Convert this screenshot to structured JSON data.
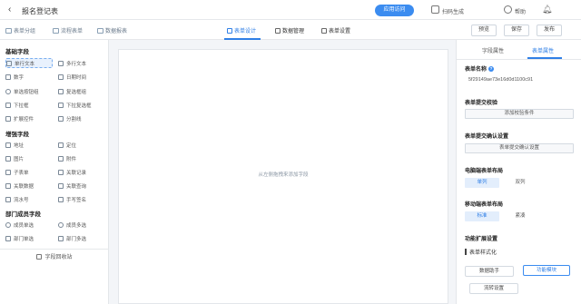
{
  "header": {
    "back_icon": "chevron-left-icon",
    "title": "报名登记表",
    "primary_button": "应用访问",
    "share_label": "扫码生成",
    "help_label": "帮助",
    "bell_icon": "bell-icon"
  },
  "subnav": {
    "left_tabs": [
      "表单分组",
      "流程表单",
      "数据报表"
    ],
    "center_tabs": [
      "表单设计",
      "数据管理",
      "表单设置"
    ],
    "active_center_tab": "表单设计",
    "buttons": [
      "预览",
      "保存",
      "发布"
    ]
  },
  "left_panel": {
    "sections": [
      {
        "title": "基础字段",
        "fields": [
          "单行文本",
          "多行文本",
          "数字",
          "日期时间",
          "单选按钮组",
          "复选框组",
          "下拉框",
          "下拉复选框",
          "扩展控件",
          "分割线"
        ]
      },
      {
        "title": "增强字段",
        "fields": [
          "地址",
          "定位",
          "图片",
          "附件",
          "子表单",
          "关联记录",
          "关联数据",
          "关联查询",
          "流水号",
          "手写签名"
        ]
      },
      {
        "title": "部门成员字段",
        "fields": [
          "成员单选",
          "成员多选",
          "部门单选",
          "部门多选"
        ]
      }
    ],
    "collect_label": "字段回收站"
  },
  "canvas": {
    "empty_tip": "从左侧拖拽来添加字段"
  },
  "right_panel": {
    "tabs": [
      "字段属性",
      "表单属性"
    ],
    "active_tab": "表单属性",
    "form_name_label": "表单名称",
    "form_name_value": "5f29149ae73e16d0d1100c91",
    "submit_check_label": "表单提交校验",
    "submit_check_button": "添加校验条件",
    "submit_confirm_label": "表单提交确认设置",
    "submit_confirm_button": "表单提交确认设置",
    "pc_layout_label": "电脑端表单布局",
    "pc_layout_options": [
      "单列",
      "双列"
    ],
    "pc_layout_selected": "单列",
    "mobile_layout_label": "移动端表单布局",
    "mobile_layout_options": [
      "标准",
      "紧凑"
    ],
    "mobile_layout_selected": "标准",
    "extend_label": "功能扩展设置",
    "checkbox_label": "表单样式化",
    "func_buttons": [
      "数据助手",
      "功能模块"
    ],
    "extra_button": "流转设置"
  }
}
